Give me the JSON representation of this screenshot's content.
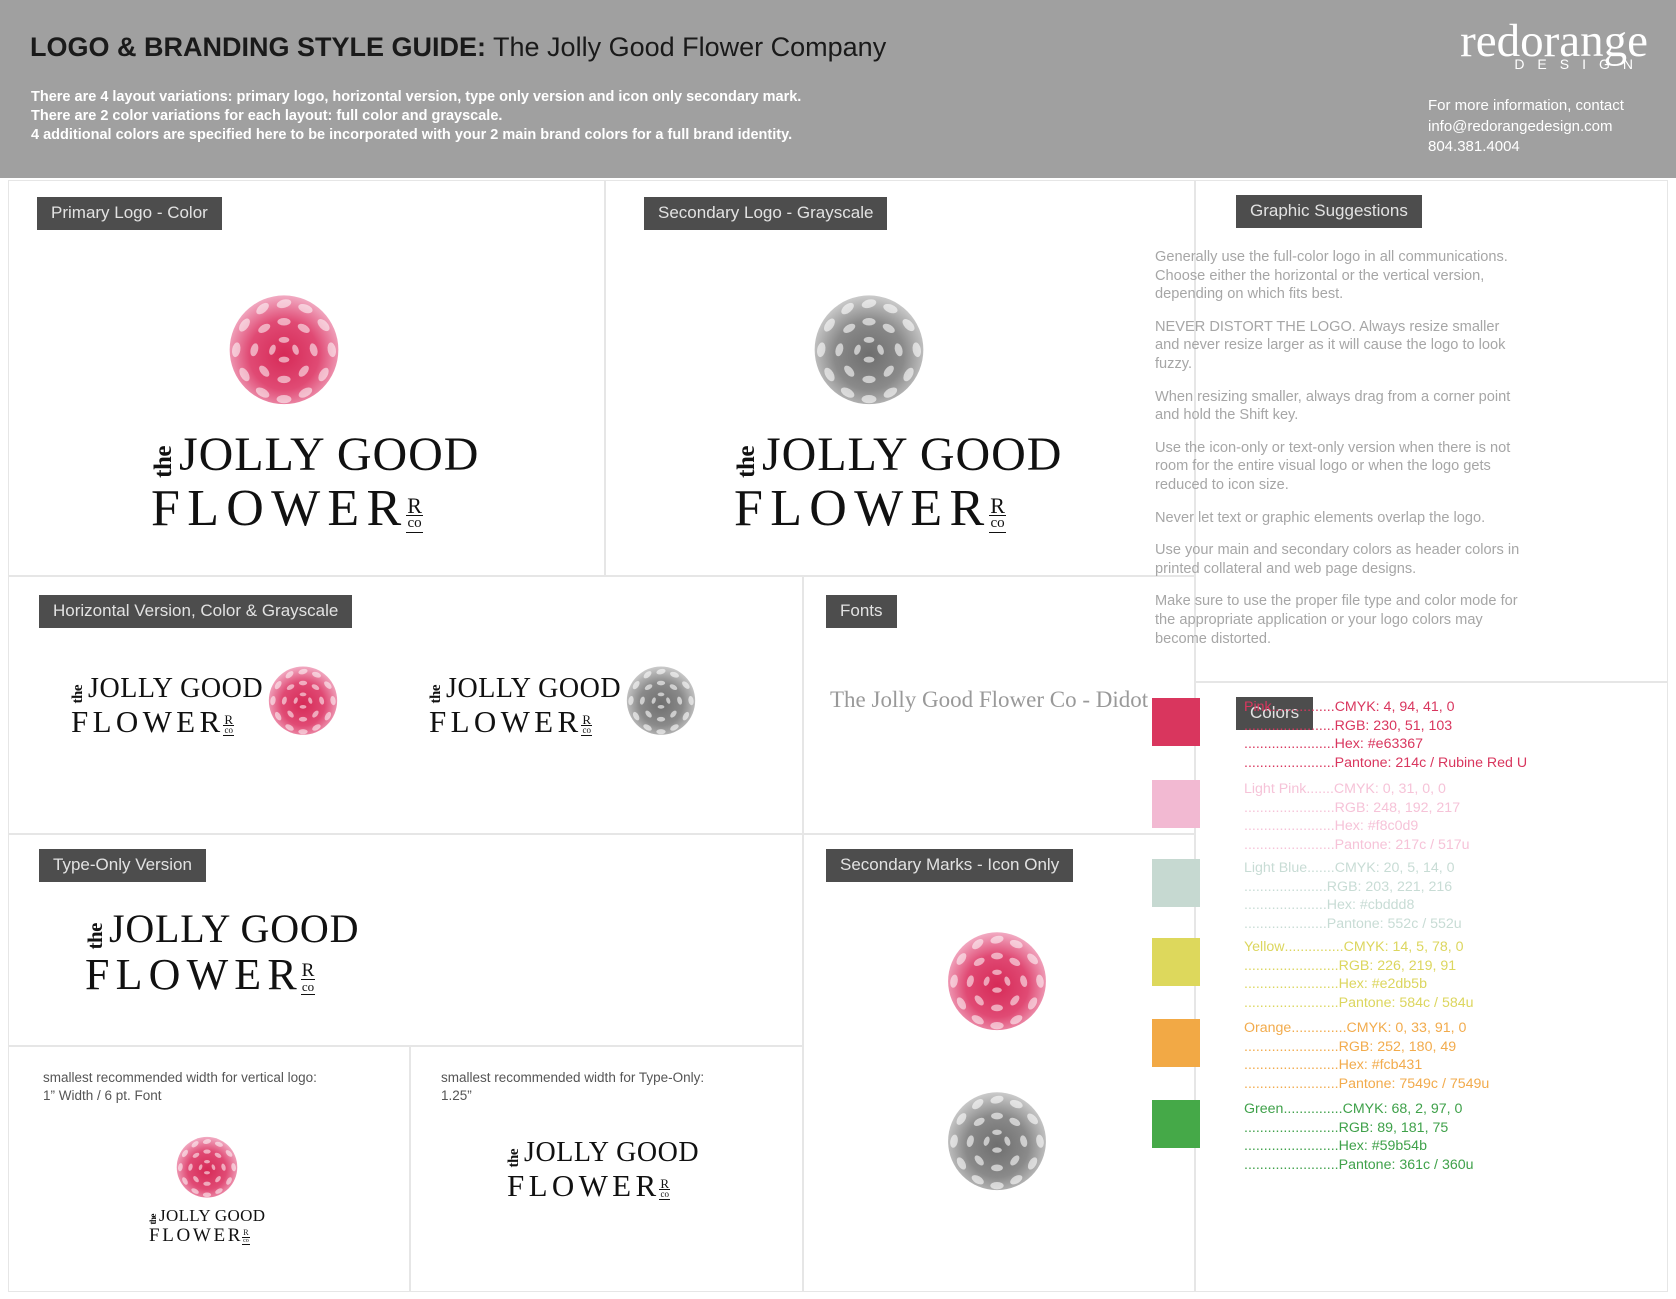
{
  "header": {
    "title_strong": "LOGO & BRANDING STYLE GUIDE:",
    "title_light": " The Jolly Good Flower Company",
    "sub_line1": "There are 4 layout variations: primary logo, horizontal version, type only version and icon only secondary mark.",
    "sub_line2": "There are 2 color variations for each layout: full color and grayscale.",
    "sub_line3": "4 additional colors are specified here to be incorporated with your 2 main brand colors for a full brand identity.",
    "brand_word": "redorange",
    "brand_sub": "DESIGN",
    "contact_line1": "For more information, contact",
    "contact_line2": "info@redorangedesign.com",
    "contact_line3": "804.381.4004"
  },
  "sections": {
    "primary_logo": "Primary Logo - Color",
    "secondary_logo": "Secondary Logo - Grayscale",
    "horizontal": "Horizontal Version, Color & Grayscale",
    "fonts": "Fonts",
    "type_only": "Type-Only Version",
    "secondary_marks": "Secondary Marks - Icon Only",
    "graphic_suggestions": "Graphic Suggestions",
    "colors": "Colors"
  },
  "logo": {
    "the": "the",
    "jolly_good": "JOLLY GOOD",
    "flower": "FLOWER",
    "r": "R",
    "co": "co"
  },
  "fonts_panel": {
    "sample": "The Jolly Good Flower Co - Didot"
  },
  "notes": {
    "vertical_line1": "smallest recommended width for vertical logo:",
    "vertical_line2": "1” Width / 6 pt. Font",
    "typeonly_line1": "smallest recommended width for Type-Only:",
    "typeonly_line2": "1.25”"
  },
  "suggestions": [
    "Generally use the full-color logo in all communications. Choose either the horizontal or the vertical version, depending on which fits best.",
    "NEVER DISTORT THE LOGO. Always resize smaller and never resize larger as it will cause the logo to look fuzzy.",
    "When resizing smaller, always drag from a corner point and hold the Shift key.",
    "Use the icon-only or text-only version when there is not room for the entire visual logo or when the logo gets reduced to icon size.",
    "Never let text or graphic elements overlap the logo.",
    "Use your main and secondary colors as header colors in printed collateral and web page designs.",
    "Make sure to use the proper file type and color mode for the appropriate application or your logo colors may become distorted."
  ],
  "colors": [
    {
      "name": "Pink",
      "swatch": "#d9365e",
      "text_color": "#d9365e",
      "dots1": "................",
      "dots2": ".......................",
      "cmyk": "CMYK: 4, 94, 41, 0",
      "rgb": "RGB: 230, 51, 103",
      "hex": "Hex: #e63367",
      "pantone": "Pantone: 214c / Rubine Red U"
    },
    {
      "name": "Light Pink",
      "swatch": "#f2b9d2",
      "text_color": "#f6c3d8",
      "dots1": ".......",
      "dots2": ".......................",
      "cmyk": "CMYK: 0, 31, 0, 0",
      "rgb": "RGB: 248, 192, 217",
      "hex": "Hex: #f8c0d9",
      "pantone": "Pantone: 217c / 517u"
    },
    {
      "name": "Light Blue",
      "swatch": "#c6d9d1",
      "text_color": "#c8dcd5",
      "dots1": ".......",
      "dots2": ".....................",
      "cmyk": "CMYK: 20, 5, 14, 0",
      "rgb": "RGB: 203, 221, 216",
      "hex": "Hex: #cbddd8",
      "pantone": "Pantone: 552c / 552u"
    },
    {
      "name": "Yellow",
      "swatch": "#ddd85c",
      "text_color": "#dcd65e",
      "dots1": "...............",
      "dots2": "........................",
      "cmyk": "CMYK: 14, 5, 78, 0",
      "rgb": "RGB: 226, 219, 91",
      "hex": "Hex: #e2db5b",
      "pantone": "Pantone: 584c / 584u"
    },
    {
      "name": "Orange",
      "swatch": "#f2a945",
      "text_color": "#f2ab4c",
      "dots1": "..............",
      "dots2": "........................",
      "cmyk": "CMYK: 0, 33, 91, 0",
      "rgb": "RGB: 252, 180, 49",
      "hex": "Hex: #fcb431",
      "pantone": "Pantone: 7549c / 7549u"
    },
    {
      "name": "Green",
      "swatch": "#45a948",
      "text_color": "#3fa14a",
      "dots1": "...............",
      "dots2": "........................",
      "cmyk": "CMYK: 68, 2, 97, 0",
      "rgb": "RGB: 89, 181, 75",
      "hex": "Hex: #59b54b",
      "pantone": "Pantone: 361c / 360u"
    }
  ]
}
